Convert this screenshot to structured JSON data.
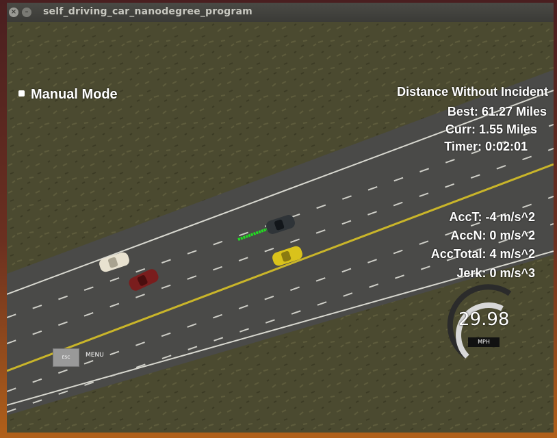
{
  "window": {
    "title": "self_driving_car_nanodegree_program",
    "close_glyph": "×",
    "minimize_glyph": "–"
  },
  "hud": {
    "manual_mode_label": "Manual Mode",
    "distance_title": "Distance Without Incident",
    "best": "Best: 61.27 Miles",
    "curr": "Curr: 1.55 Miles",
    "timer": "Timer: 0:02:01",
    "acc_t": "AccT: -4 m/s^2",
    "acc_n": "AccN: 0 m/s^2",
    "acc_total": "AccTotal: 4 m/s^2",
    "jerk": "Jerk: 0 m/s^3"
  },
  "speedometer": {
    "speed": "29.98",
    "unit": "MPH",
    "fill_fraction": 0.6
  },
  "controls": {
    "esc_label": "ESC",
    "menu_label": "MENU"
  },
  "colors": {
    "grass": "#4b4a30",
    "road": "#4a4a48",
    "center_line": "#c9b52a",
    "path": "#22dd22",
    "ego_car": "#2f3438",
    "yellow_car": "#d9c21b",
    "red_car": "#7a1d1d",
    "white_car": "#e8e2d0"
  }
}
